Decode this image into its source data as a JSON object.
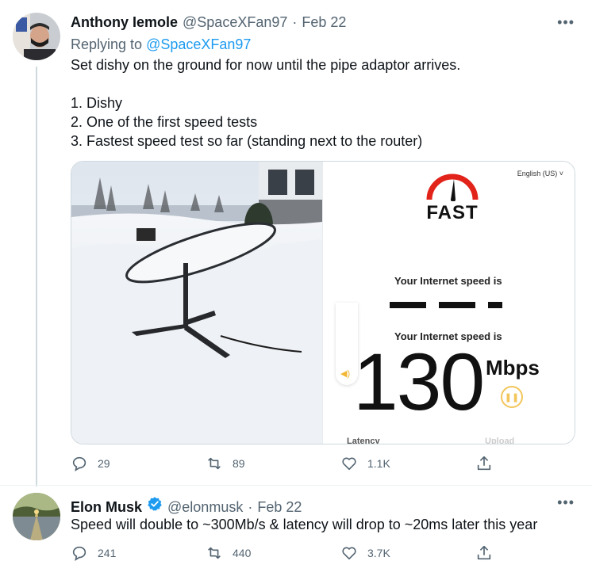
{
  "tweets": [
    {
      "author": {
        "name": "Anthony Iemole",
        "handle": "@SpaceXFan97",
        "separator": "·",
        "date": "Feb 22"
      },
      "replying_prefix": "Replying to",
      "replying_handle": "@SpaceXFan97",
      "text": "Set dishy on the ground for now until the pipe adaptor arrives.\n\n1. Dishy\n2. One of the first speed tests\n3. Fastest speed test so far (standing next to the router)",
      "media": {
        "fast": {
          "language": "English (US) ˅",
          "logo": "FAST",
          "label_top": "Your Internet speed is",
          "label_main": "Your Internet speed is",
          "value": "130",
          "unit": "Mbps",
          "bottom_left": "Latency",
          "bottom_right": "Upload"
        }
      },
      "actions": {
        "replies": "29",
        "retweets": "89",
        "likes": "1.1K"
      }
    },
    {
      "author": {
        "name": "Elon Musk",
        "handle": "@elonmusk",
        "separator": "·",
        "date": "Feb 22"
      },
      "text": "Speed will double to ~300Mb/s & latency will drop to ~20ms later this year",
      "actions": {
        "replies": "241",
        "retweets": "440",
        "likes": "3.7K"
      }
    }
  ],
  "more_icon": "more-horizontal-icon",
  "colors": {
    "link": "#1d9bf0",
    "muted": "#536471",
    "verified": "#1d9bf0",
    "fast_red": "#e2231a"
  }
}
